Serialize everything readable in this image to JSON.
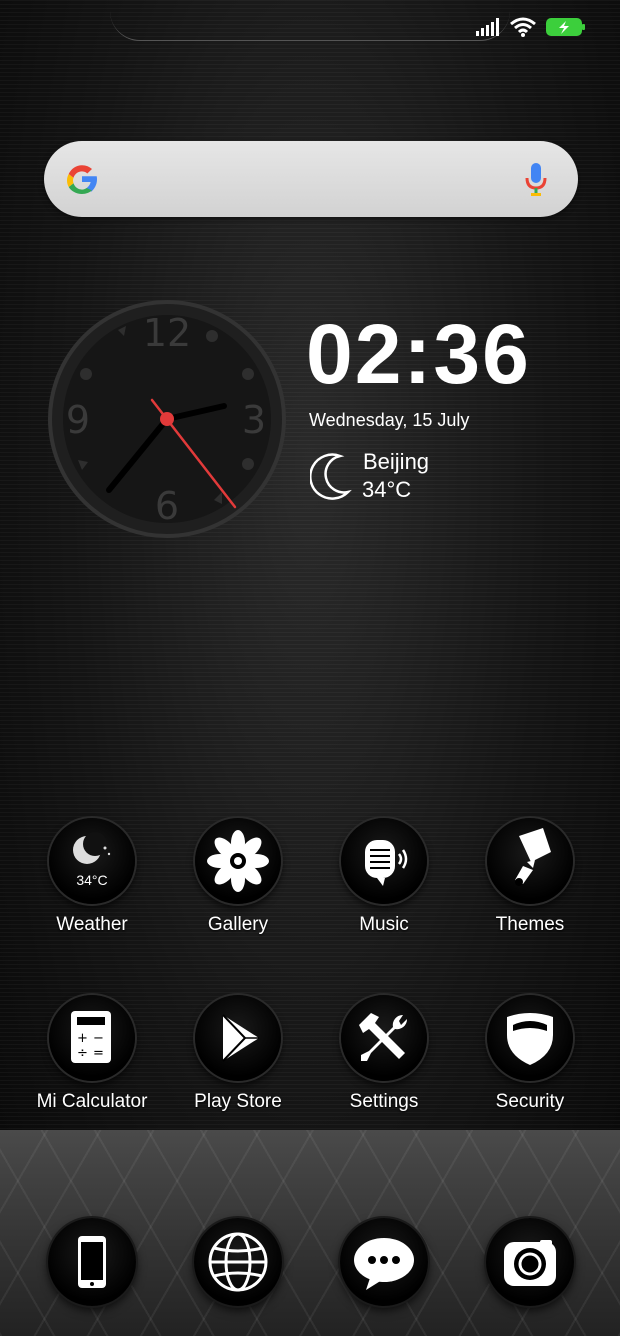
{
  "status_bar": {
    "signal_icon": "signal-icon",
    "wifi_icon": "wifi-icon",
    "battery_icon": "battery-charging-icon",
    "battery_color": "#3ccf3c"
  },
  "search": {
    "logo_icon": "google-icon",
    "mic_icon": "mic-icon"
  },
  "clock_widget": {
    "time": "02:36",
    "date": "Wednesday, 15 July",
    "analog_numbers": [
      "12",
      "3",
      "6",
      "9"
    ],
    "second_hand_color": "#e23a3a"
  },
  "weather_widget": {
    "icon": "moon-icon",
    "city": "Beijing",
    "temperature": "34°C"
  },
  "apps": [
    {
      "label": "Weather",
      "icon": "weather-icon",
      "badge": "34°C"
    },
    {
      "label": "Gallery",
      "icon": "flower-icon"
    },
    {
      "label": "Music",
      "icon": "music-icon"
    },
    {
      "label": "Themes",
      "icon": "paintbrush-icon"
    },
    {
      "label": "Mi Calculator",
      "icon": "calculator-icon"
    },
    {
      "label": "Play Store",
      "icon": "play-icon"
    },
    {
      "label": "Settings",
      "icon": "tools-icon"
    },
    {
      "label": "Security",
      "icon": "shield-icon"
    }
  ],
  "dock": [
    {
      "icon": "phone-icon"
    },
    {
      "icon": "globe-icon"
    },
    {
      "icon": "message-icon"
    },
    {
      "icon": "camera-icon"
    }
  ]
}
